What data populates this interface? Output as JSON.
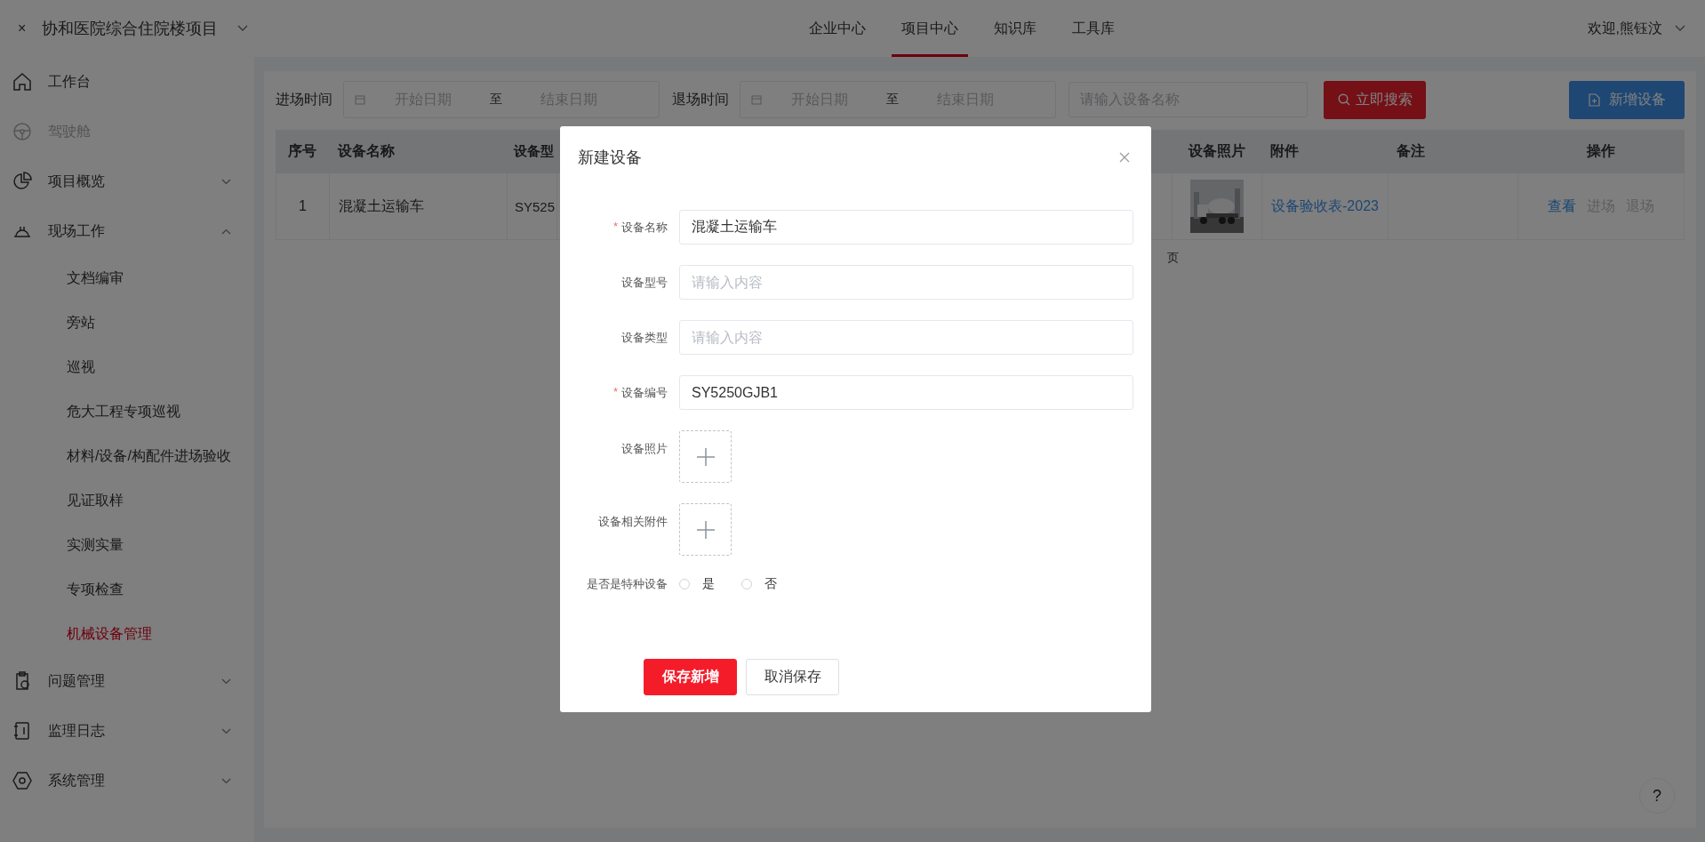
{
  "header": {
    "close_mark": "×",
    "project": "协和医院综合住院楼项目",
    "nav": [
      {
        "label": "企业中心",
        "selected": false
      },
      {
        "label": "项目中心",
        "selected": true
      },
      {
        "label": "知识库",
        "selected": false
      },
      {
        "label": "工具库",
        "selected": false
      }
    ],
    "user": "欢迎,熊钰汶"
  },
  "sidebar": {
    "items": [
      {
        "label": "工作台",
        "kind": "link",
        "disabled": false
      },
      {
        "label": "驾驶舱",
        "kind": "link",
        "disabled": true
      },
      {
        "label": "项目概览",
        "kind": "group",
        "disabled": false,
        "expanded": false
      },
      {
        "label": "现场工作",
        "kind": "group",
        "disabled": false,
        "expanded": true,
        "children": [
          {
            "label": "文档编审",
            "selected": false
          },
          {
            "label": "旁站",
            "selected": false
          },
          {
            "label": "巡视",
            "selected": false
          },
          {
            "label": "危大工程专项巡视",
            "selected": false
          },
          {
            "label": "材料/设备/构配件进场验收",
            "selected": false
          },
          {
            "label": "见证取样",
            "selected": false
          },
          {
            "label": "实测实量",
            "selected": false
          },
          {
            "label": "专项检查",
            "selected": false
          },
          {
            "label": "机械设备管理",
            "selected": true
          }
        ]
      },
      {
        "label": "问题管理",
        "kind": "group",
        "disabled": false,
        "expanded": false
      },
      {
        "label": "监理日志",
        "kind": "group",
        "disabled": false,
        "expanded": false
      },
      {
        "label": "系统管理",
        "kind": "group",
        "disabled": false,
        "expanded": false
      }
    ]
  },
  "filters": {
    "date_ranges": [
      {
        "label": "进场时间",
        "start_placeholder": "开始日期",
        "separator": "至",
        "end_placeholder": "结束日期"
      },
      {
        "label": "退场时间",
        "start_placeholder": "开始日期",
        "separator": "至",
        "end_placeholder": "结束日期"
      }
    ],
    "search_placeholder": "请输入设备名称",
    "search_button": "立即搜索",
    "add_button": "新增设备"
  },
  "table": {
    "columns_left": [
      "序号",
      "设备名称",
      "设备型"
    ],
    "columns_right": [
      "设备照片",
      "附件",
      "备注",
      "操作"
    ],
    "rows": [
      {
        "index": "1",
        "name": "混凝土运输车",
        "model": "SY525",
        "photo": {
          "kind": "picture"
        },
        "attachment": "设备验收表-2023",
        "actions": [
          {
            "label": "查看",
            "disabled": false
          },
          {
            "label": "进场",
            "disabled": true
          },
          {
            "label": "退场",
            "disabled": true
          }
        ]
      }
    ],
    "pagination_tail": "页"
  },
  "help_button": "?",
  "dialog": {
    "title": "新建设备",
    "fields": [
      {
        "kind": "text",
        "label": "设备名称",
        "required_mark": "*",
        "value": "混凝土运输车"
      },
      {
        "kind": "text",
        "label": "设备型号",
        "placeholder": "请输入内容"
      },
      {
        "kind": "text",
        "label": "设备类型",
        "placeholder": "请输入内容"
      },
      {
        "kind": "text",
        "label": "设备编号",
        "required_mark": "*",
        "value": "SY5250GJB1"
      },
      {
        "kind": "upload",
        "label": "设备照片"
      },
      {
        "kind": "upload",
        "label": "设备相关附件"
      },
      {
        "kind": "radio",
        "label": "是否是特种设备",
        "options": [
          {
            "label": "是",
            "selected": false
          },
          {
            "label": "否",
            "selected": false
          }
        ]
      }
    ],
    "buttons": [
      {
        "label": "保存新增",
        "kind": "primary"
      },
      {
        "label": "取消保存",
        "kind": "plain"
      }
    ]
  }
}
